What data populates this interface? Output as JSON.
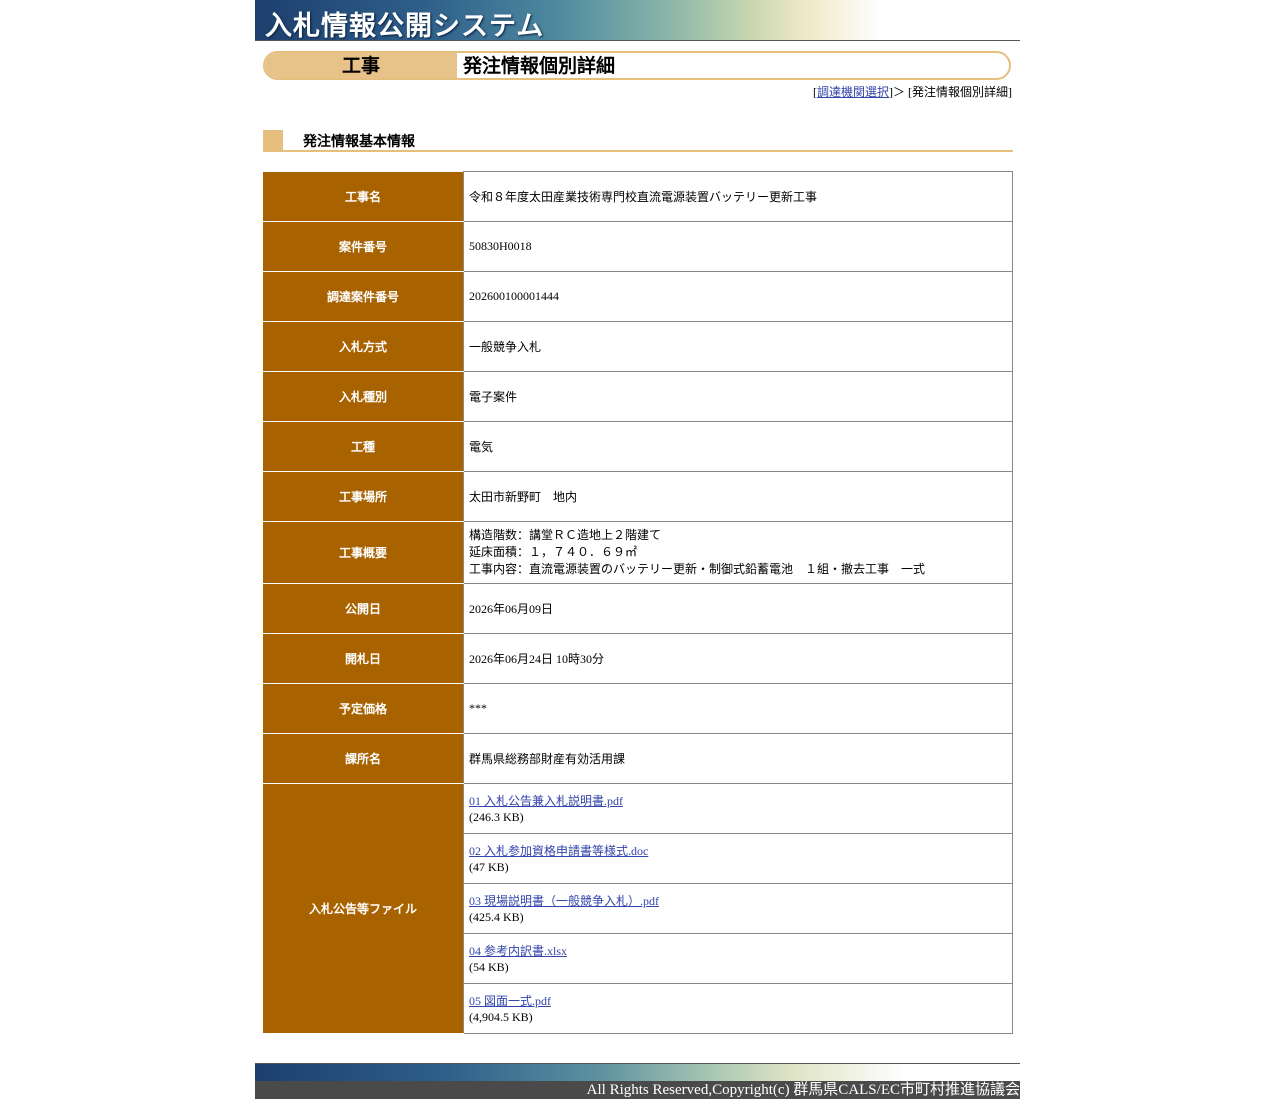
{
  "header": {
    "system_title": "入札情報公開システム"
  },
  "titlebar": {
    "category": "工事",
    "label": "発注情報個別詳細"
  },
  "breadcrumb": {
    "open": "[",
    "link": "調達機関選択",
    "sep": "]＞ [",
    "current": "発注情報個別詳細",
    "close": "]"
  },
  "section": {
    "heading": "発注情報基本情報"
  },
  "details": {
    "construction_name": {
      "label": "工事名",
      "value": "令和８年度太田産業技術専門校直流電源装置バッテリー更新工事"
    },
    "case_number": {
      "label": "案件番号",
      "value": "50830H0018"
    },
    "procurement_number": {
      "label": "調達案件番号",
      "value": "202600100001444"
    },
    "bid_method": {
      "label": "入札方式",
      "value": "一般競争入札"
    },
    "bid_type": {
      "label": "入札種別",
      "value": "電子案件"
    },
    "work_type": {
      "label": "工種",
      "value": "電気"
    },
    "location": {
      "label": "工事場所",
      "value": "太田市新野町　地内"
    },
    "overview": {
      "label": "工事概要",
      "lines": [
        "構造階数：講堂ＲＣ造地上２階建て",
        "延床面積：１，７４０．６９㎡",
        "工事内容：直流電源装置のバッテリー更新・制御式鉛蓄電池　１組・撤去工事　一式"
      ]
    },
    "publish_date": {
      "label": "公開日",
      "value": "2026年06月09日"
    },
    "opening_date": {
      "label": "開札日",
      "value": "2026年06月24日 10時30分"
    },
    "estimated_price": {
      "label": "予定価格",
      "value": "***"
    },
    "department": {
      "label": "課所名",
      "value": "群馬県総務部財産有効活用課"
    },
    "files": {
      "label": "入札公告等ファイル",
      "items": [
        {
          "name": "01 入札公告兼入札説明書.pdf",
          "size": "(246.3 KB)"
        },
        {
          "name": "02  入札参加資格申請書等様式.doc",
          "size": "(47 KB)"
        },
        {
          "name": "03 現場説明書（一般競争入札）.pdf",
          "size": "(425.4 KB)"
        },
        {
          "name": "04 参考内訳書.xlsx",
          "size": "(54 KB)"
        },
        {
          "name": "05 図面一式.pdf",
          "size": "(4,904.5 KB)"
        }
      ]
    }
  },
  "footer": {
    "copyright": "All Rights Reserved,Copyright(c) 群馬県CALS/EC市町村推進協議会"
  },
  "colors": {
    "header_th": "#a96200",
    "accent": "#e6bf7e",
    "link": "#3344aa"
  }
}
